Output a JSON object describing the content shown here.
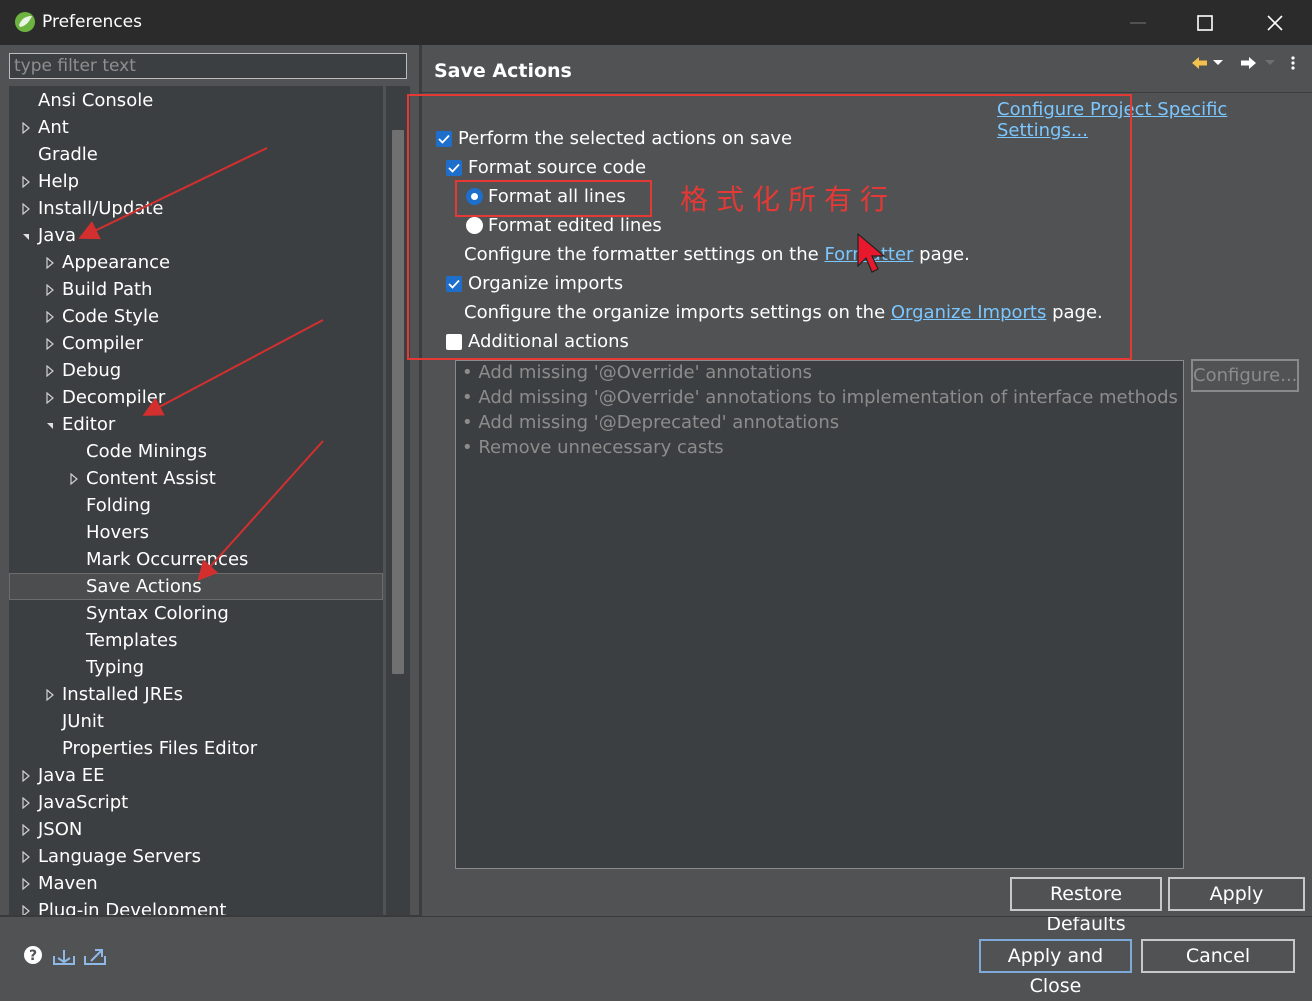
{
  "window": {
    "title": "Preferences",
    "controls": [
      "minimize-icon",
      "maximize-icon",
      "close-icon"
    ]
  },
  "filter": {
    "placeholder": "type filter text",
    "value": ""
  },
  "tree": {
    "items": [
      {
        "label": "Ansi Console",
        "level": 0,
        "expander": "none"
      },
      {
        "label": "Ant",
        "level": 0,
        "expander": "collapsed"
      },
      {
        "label": "Gradle",
        "level": 0,
        "expander": "none"
      },
      {
        "label": "Help",
        "level": 0,
        "expander": "collapsed"
      },
      {
        "label": "Install/Update",
        "level": 0,
        "expander": "collapsed"
      },
      {
        "label": "Java",
        "level": 0,
        "expander": "expanded"
      },
      {
        "label": "Appearance",
        "level": 1,
        "expander": "collapsed"
      },
      {
        "label": "Build Path",
        "level": 1,
        "expander": "collapsed"
      },
      {
        "label": "Code Style",
        "level": 1,
        "expander": "collapsed"
      },
      {
        "label": "Compiler",
        "level": 1,
        "expander": "collapsed"
      },
      {
        "label": "Debug",
        "level": 1,
        "expander": "collapsed"
      },
      {
        "label": "Decompiler",
        "level": 1,
        "expander": "collapsed"
      },
      {
        "label": "Editor",
        "level": 1,
        "expander": "expanded"
      },
      {
        "label": "Code Minings",
        "level": 2,
        "expander": "none"
      },
      {
        "label": "Content Assist",
        "level": 2,
        "expander": "collapsed"
      },
      {
        "label": "Folding",
        "level": 2,
        "expander": "none"
      },
      {
        "label": "Hovers",
        "level": 2,
        "expander": "none"
      },
      {
        "label": "Mark Occurrences",
        "level": 2,
        "expander": "none"
      },
      {
        "label": "Save Actions",
        "level": 2,
        "expander": "none",
        "selected": true
      },
      {
        "label": "Syntax Coloring",
        "level": 2,
        "expander": "none"
      },
      {
        "label": "Templates",
        "level": 2,
        "expander": "none"
      },
      {
        "label": "Typing",
        "level": 2,
        "expander": "none"
      },
      {
        "label": "Installed JREs",
        "level": 1,
        "expander": "collapsed"
      },
      {
        "label": "JUnit",
        "level": 1,
        "expander": "none"
      },
      {
        "label": "Properties Files Editor",
        "level": 1,
        "expander": "none"
      },
      {
        "label": "Java EE",
        "level": 0,
        "expander": "collapsed"
      },
      {
        "label": "JavaScript",
        "level": 0,
        "expander": "collapsed"
      },
      {
        "label": "JSON",
        "level": 0,
        "expander": "collapsed"
      },
      {
        "label": "Language Servers",
        "level": 0,
        "expander": "collapsed"
      },
      {
        "label": "Maven",
        "level": 0,
        "expander": "collapsed"
      },
      {
        "label": "Plug-in Development",
        "level": 0,
        "expander": "collapsed"
      }
    ]
  },
  "page": {
    "title": "Save Actions",
    "configure_project_link": "Configure Project Specific Settings...",
    "perform_on_save": {
      "label": "Perform the selected actions on save",
      "checked": true
    },
    "format_source": {
      "label": "Format source code",
      "checked": true
    },
    "format_all_lines": {
      "label": "Format all lines",
      "selected": true
    },
    "format_edited_lines": {
      "label": "Format edited lines",
      "selected": false
    },
    "formatter_note": {
      "before": "Configure the formatter settings on the ",
      "link": "Formatter",
      "after": " page."
    },
    "organize_imports": {
      "label": "Organize imports",
      "checked": true
    },
    "organize_note": {
      "before": "Configure the organize imports settings on the ",
      "link": "Organize Imports",
      "after": " page."
    },
    "additional_actions": {
      "label": "Additional actions",
      "checked": false
    },
    "additional_list": [
      "Add missing '@Override' annotations",
      "Add missing '@Override' annotations to implementation of interface methods",
      "Add missing '@Deprecated' annotations",
      "Remove unnecessary casts"
    ],
    "configure_button": "Configure...",
    "restore_defaults_button": "Restore Defaults",
    "apply_button": "Apply"
  },
  "footer": {
    "apply_and_close_button": "Apply and Close",
    "cancel_button": "Cancel",
    "icons": [
      "help-icon",
      "import-icon",
      "export-icon"
    ]
  },
  "annotation": {
    "note": "格式化所有行",
    "color": "#e53935"
  },
  "colors": {
    "background": "#505254",
    "tree_background": "#3c3f41",
    "titlebar": "#2b2b2b",
    "link": "#7cc7ff",
    "checkbox": "#1e6fcc"
  }
}
